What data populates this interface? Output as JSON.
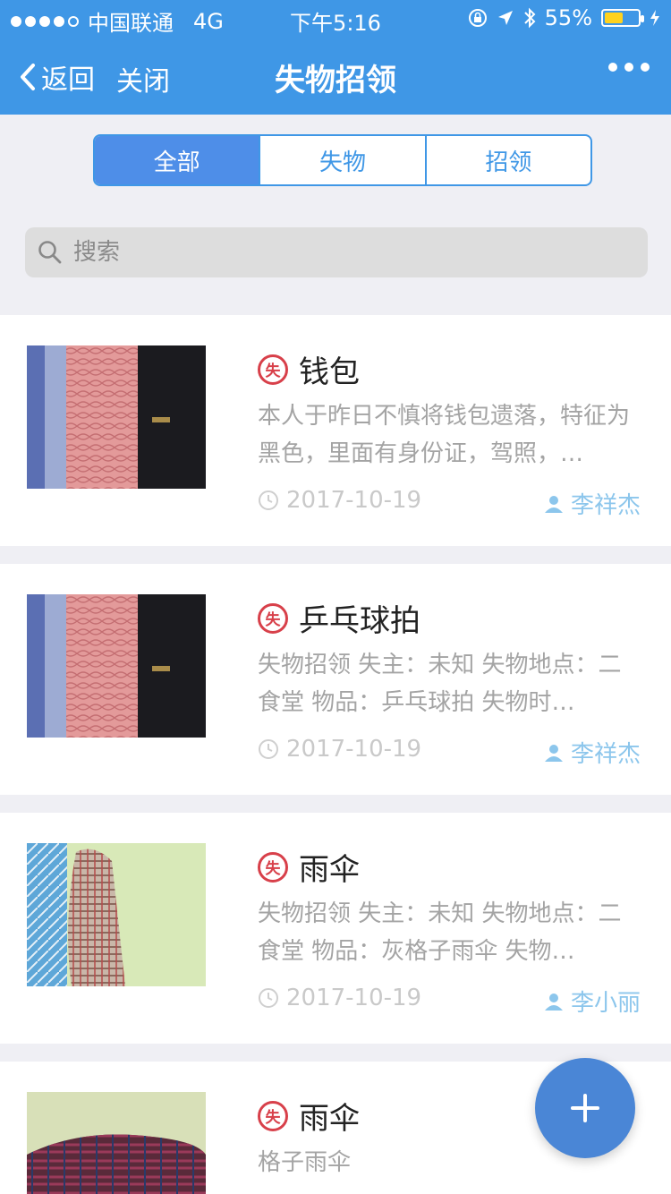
{
  "status_bar": {
    "carrier": "中国联通",
    "network": "4G",
    "time": "下午5:16",
    "battery": "55%",
    "battery_level": 0.55
  },
  "nav": {
    "back_label": "返回",
    "close_label": "关闭",
    "title": "失物招领"
  },
  "tabs": [
    {
      "label": "全部",
      "active": true
    },
    {
      "label": "失物",
      "active": false
    },
    {
      "label": "招领",
      "active": false
    }
  ],
  "search": {
    "placeholder": "搜索"
  },
  "items": [
    {
      "badge": "失",
      "title": "钱包",
      "description": "本人于昨日不慎将钱包遗落，特征为黑色，里面有身份证，驾照，…",
      "date": "2017-10-19",
      "user": "李祥杰",
      "thumb": "wallet"
    },
    {
      "badge": "失",
      "title": "乒乓球拍",
      "description": "失物招领 失主：未知 失物地点：二食堂 物品：乒乓球拍 失物时…",
      "date": "2017-10-19",
      "user": "李祥杰",
      "thumb": "wallet"
    },
    {
      "badge": "失",
      "title": "雨伞",
      "description": "失物招领 失主：未知 失物地点：二食堂 物品：灰格子雨伞 失物…",
      "date": "2017-10-19",
      "user": "李小丽",
      "thumb": "umbrella-plaid"
    },
    {
      "badge": "失",
      "title": "雨伞",
      "description": "格子雨伞",
      "date": "",
      "user": "",
      "thumb": "umbrella-dark"
    }
  ],
  "fab": {
    "icon": "plus-icon"
  },
  "colors": {
    "primary": "#3f97e6",
    "lost_badge": "#d8404a",
    "user": "#8cc6ec"
  }
}
